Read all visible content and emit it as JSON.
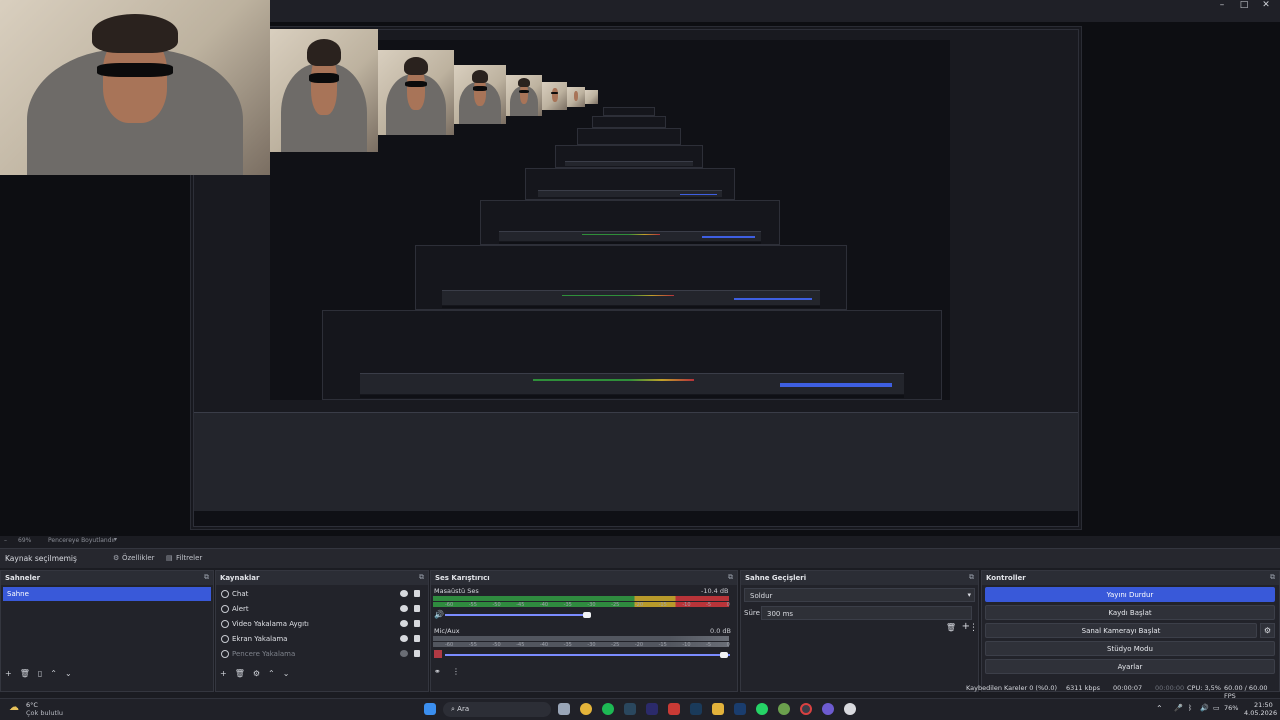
{
  "window": {
    "minimize": "–",
    "maximize": "□",
    "close": "✕"
  },
  "zoom": {
    "percent": "69%",
    "mode": "Pencereye Boyutlandır"
  },
  "source_bar": {
    "title": "Kaynak seçilmemiş",
    "properties": "Özellikler",
    "filters": "Filtreler"
  },
  "panels": {
    "scenes": {
      "title": "Sahneler",
      "items": [
        {
          "label": "Sahne",
          "selected": true
        }
      ]
    },
    "sources": {
      "title": "Kaynaklar",
      "items": [
        {
          "label": "Chat"
        },
        {
          "label": "Alert"
        },
        {
          "label": "Video Yakalama Aygıtı"
        },
        {
          "label": "Ekran Yakalama"
        },
        {
          "label": "Pencere Yakalama",
          "hidden": true
        }
      ]
    },
    "mixer": {
      "title": "Ses Karıştırıcı",
      "channels": [
        {
          "name": "Masaüstü Ses",
          "db": "-10.4 dB",
          "level": 0.82
        },
        {
          "name": "Mic/Aux",
          "db": "0.0 dB",
          "level": 0.0
        }
      ],
      "ticks": [
        "-60",
        "-55",
        "-50",
        "-45",
        "-40",
        "-35",
        "-30",
        "-25",
        "-20",
        "-15",
        "-10",
        "-5",
        "0"
      ]
    },
    "transitions": {
      "title": "Sahne Geçişleri",
      "type": "Soldur",
      "duration_label": "Süre",
      "duration_value": "300 ms"
    },
    "controls": {
      "title": "Kontroller",
      "buttons": [
        "Yayını Durdur",
        "Kaydı Başlat",
        "Sanal Kamerayı Başlat",
        "Stüdyo Modu",
        "Ayarlar"
      ]
    }
  },
  "status": {
    "dropped": "Kaybedilen Kareler 0 (%0.0)",
    "bitrate": "6311 kbps",
    "live": "00:00:07",
    "rec": "00:00:00",
    "cpu": "CPU: 3,5%",
    "fps": "60.00 / 60.00 FPS"
  },
  "taskbar": {
    "weather_temp": "6°C",
    "weather_desc": "Çok bulutlu",
    "search": "Ara",
    "battery": "76%",
    "time": "21:50",
    "date": "4.05.2026"
  },
  "colors": {
    "accent": "#3959d9",
    "meter_green": "#2f8b3f",
    "meter_yellow": "#b89a2b",
    "meter_red": "#b83439"
  }
}
